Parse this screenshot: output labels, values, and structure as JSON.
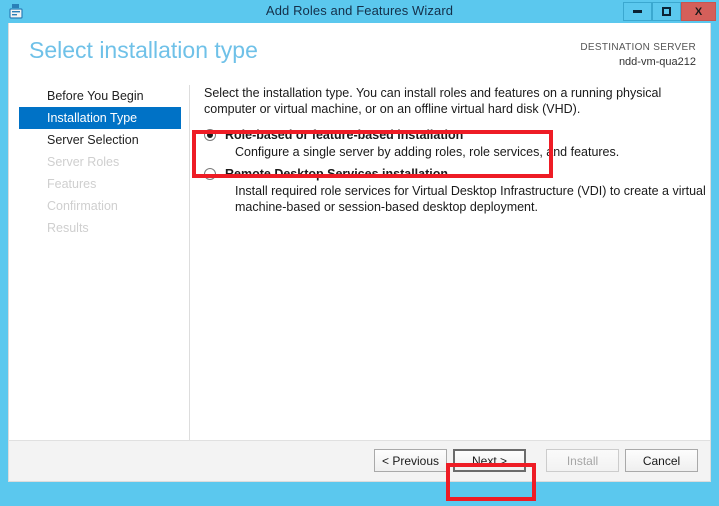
{
  "window": {
    "title": "Add Roles and Features Wizard",
    "icon": "server-wizard-icon",
    "controls": {
      "minimize": "minimize-icon",
      "maximize": "maximize-icon",
      "close": "X"
    }
  },
  "header": {
    "page_title": "Select installation type",
    "destination_label": "DESTINATION SERVER",
    "destination_server": "ndd-vm-qua212"
  },
  "sidebar": {
    "items": [
      {
        "label": "Before You Begin",
        "state": "enabled"
      },
      {
        "label": "Installation Type",
        "state": "selected"
      },
      {
        "label": "Server Selection",
        "state": "enabled"
      },
      {
        "label": "Server Roles",
        "state": "disabled"
      },
      {
        "label": "Features",
        "state": "disabled"
      },
      {
        "label": "Confirmation",
        "state": "disabled"
      },
      {
        "label": "Results",
        "state": "disabled"
      }
    ]
  },
  "main": {
    "intro": "Select the installation type. You can install roles and features on a running physical computer or virtual machine, or on an offline virtual hard disk (VHD).",
    "options": [
      {
        "title": "Role-based or feature-based installation",
        "description": "Configure a single server by adding roles, role services, and features.",
        "selected": true
      },
      {
        "title": "Remote Desktop Services installation",
        "description": "Install required role services for Virtual Desktop Infrastructure (VDI) to create a virtual machine-based or session-based desktop deployment.",
        "selected": false
      }
    ]
  },
  "footer": {
    "previous": "< Previous",
    "next": "Next >",
    "install": "Install",
    "cancel": "Cancel"
  },
  "annotations": {
    "highlight_color": "#ee1c25",
    "boxes": [
      {
        "target": "role-based-installation-option"
      },
      {
        "target": "next-button"
      }
    ]
  },
  "colors": {
    "window_frame": "#5bc8ee",
    "title_accent": "#6fc1e8",
    "selection_blue": "#0072c6",
    "close_button": "#d45f5a"
  }
}
